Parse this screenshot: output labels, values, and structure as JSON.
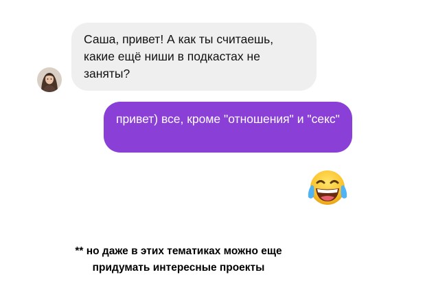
{
  "chat": {
    "incoming": {
      "text": "Саша, привет! А как ты считаешь, какие ещё ниши в подкастах не заняты?",
      "bubble_color": "#efefef",
      "avatar_icon": "profile-photo"
    },
    "outgoing": {
      "text": "привет) все, кроме \"отношения\" и \"секс\"",
      "bubble_color": "#8a3fd6",
      "text_color": "#ffffff"
    },
    "reaction": {
      "icon": "face-with-tears-of-joy-emoji"
    }
  },
  "footnote": {
    "line1": "** но даже в этих тематиках можно еще",
    "line2": "придумать интересные проекты"
  }
}
